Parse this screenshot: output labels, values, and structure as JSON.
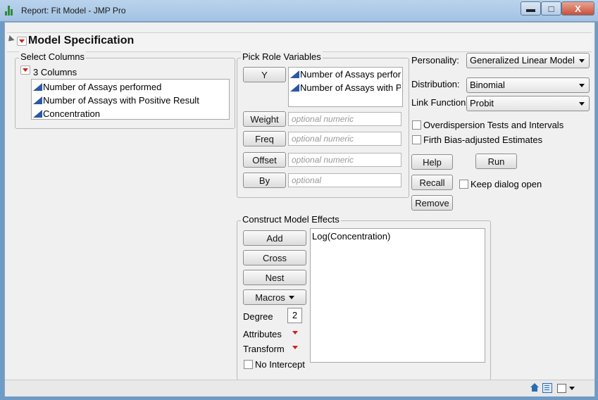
{
  "window": {
    "title": "Report: Fit Model - JMP Pro",
    "minimize": "▬",
    "maximize": "□",
    "close": "X"
  },
  "section": {
    "title": "Model Specification"
  },
  "select_columns": {
    "legend": "Select Columns",
    "count_label": "3 Columns",
    "items": [
      "Number of Assays performed",
      "Number of Assays with Positive Result",
      "Concentration"
    ]
  },
  "pick_role": {
    "legend": "Pick Role Variables",
    "y_label": "Y",
    "y_items": [
      "Number of Assays performed",
      "Number of Assays with Positive Result"
    ],
    "weight_label": "Weight",
    "weight_placeholder": "optional numeric",
    "freq_label": "Freq",
    "freq_placeholder": "optional numeric",
    "offset_label": "Offset",
    "offset_placeholder": "optional numeric",
    "by_label": "By",
    "by_placeholder": "optional"
  },
  "options": {
    "personality_label": "Personality:",
    "personality_value": "Generalized Linear Model",
    "distribution_label": "Distribution:",
    "distribution_value": "Binomial",
    "link_label": "Link Function",
    "link_value": "Probit",
    "overdispersion_label": "Overdispersion Tests and Intervals",
    "overdispersion_checked": false,
    "firth_label": "Firth Bias-adjusted Estimates",
    "firth_checked": false,
    "help_label": "Help",
    "run_label": "Run",
    "recall_label": "Recall",
    "keep_open_label": "Keep dialog open",
    "keep_open_checked": false,
    "remove_label": "Remove"
  },
  "construct": {
    "legend": "Construct Model Effects",
    "add_label": "Add",
    "cross_label": "Cross",
    "nest_label": "Nest",
    "macros_label": "Macros",
    "degree_label": "Degree",
    "degree_value": "2",
    "attributes_label": "Attributes",
    "transform_label": "Transform",
    "no_intercept_label": "No Intercept",
    "no_intercept_checked": false,
    "effects": [
      "Log(Concentration)"
    ]
  },
  "colors": {
    "accent_red": "#d0201a",
    "column_icon_blue": "#2b58a6"
  }
}
